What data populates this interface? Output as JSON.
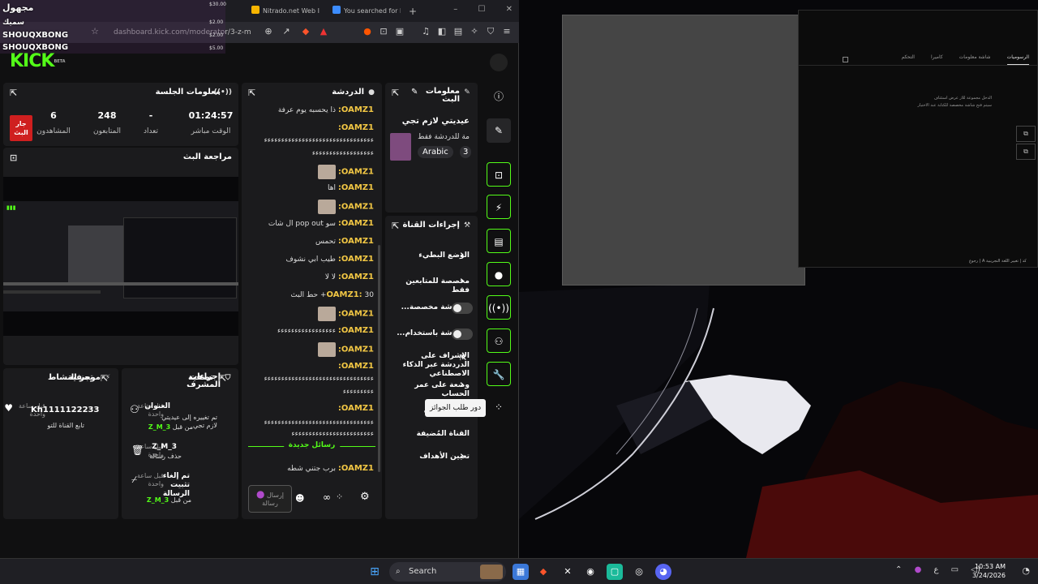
{
  "browser": {
    "tabs": [
      {
        "title": "Nitrado.net Web I",
        "color": "#f7b500"
      },
      {
        "title": "You searched for b",
        "color": "#3c8cff"
      }
    ],
    "new_tab": "+",
    "address": "dashboard.kick.com/moderator/3-z-m",
    "window_controls": [
      "–",
      "☐",
      "✕"
    ]
  },
  "donations": {
    "header": "مجهول",
    "rows": [
      {
        "name": "سميك",
        "amount": "$2.00"
      },
      {
        "name": "SHOUQXBONG",
        "amount": "$2.00"
      },
      {
        "name": "SHOUQXBONG",
        "amount": "$5.00"
      }
    ],
    "top_amount": "$30.00"
  },
  "kick": {
    "logo": "KICK",
    "beta": "BETA"
  },
  "session": {
    "title": "معلومات الجلسة",
    "stats": [
      {
        "value": "01:24:57",
        "label": "الوقت مباشر"
      },
      {
        "value": "-",
        "label": "تعداد"
      },
      {
        "value": "248",
        "label": "المتابعون"
      },
      {
        "value": "6",
        "label": "المشاهدون"
      }
    ],
    "live_badge": "جار البث"
  },
  "preview": {
    "title": "مراجعة البث"
  },
  "chat": {
    "title": "الدردشة",
    "messages": [
      {
        "user": "OAMZ1:",
        "text": "ذا يحسبه يوم عرفة"
      },
      {
        "user": "OAMZ1:",
        "text": ""
      },
      {
        "user": "",
        "text": "ءءءءءءءءءءءءءءءءءءءءءءءءءءءءءءءء"
      },
      {
        "user": "",
        "text": "ءءءءءءءءءءءءءءءءءء"
      },
      {
        "user": "OAMZ1:",
        "text": "",
        "emote": true
      },
      {
        "user": "OAMZ1:",
        "text": "اها"
      },
      {
        "user": "OAMZ1:",
        "text": "",
        "emote": true
      },
      {
        "user": "OAMZ1:",
        "text": "سو pop out ال شات"
      },
      {
        "user": "OAMZ1:",
        "text": "تحمس"
      },
      {
        "user": "OAMZ1:",
        "text": "طيب ابي نشوف"
      },
      {
        "user": "OAMZ1:",
        "text": "لا لا"
      },
      {
        "user": "OAMZ1:",
        "text": "30+ حط البث"
      },
      {
        "user": "OAMZ1:",
        "text": "",
        "emote": true
      },
      {
        "user": "OAMZ1:",
        "text": "ءءءءءءءءءءءءءءءءء"
      },
      {
        "user": "OAMZ1:",
        "text": "",
        "emote": true
      },
      {
        "user": "OAMZ1:",
        "text": ""
      },
      {
        "user": "",
        "text": "ءءءءءءءءءءءءءءءءءءءءءءءءءءءءءءءء"
      },
      {
        "user": "",
        "text": "ءءءءءءءءء"
      },
      {
        "user": "OAMZ1:",
        "text": ""
      },
      {
        "user": "",
        "text": "ءءءءءءءءءءءءءءءءءءءءءءءءءءءءءءءء"
      },
      {
        "user": "",
        "text": "ءءءءءءءءءءءءءءءءءءءءءءءء"
      }
    ],
    "new_messages": "رسائل جديدة",
    "last_message": {
      "user": "OAMZ1:",
      "text": "برب جتني شطه"
    },
    "input_placeholder": "إرسال رسالة"
  },
  "stream_info": {
    "title": "معلومات البث",
    "stream_title": "عيديتي لازم تجي",
    "category_text": "مة للدردشة فقط",
    "language": "Arabic",
    "count": "3"
  },
  "channel_actions": {
    "title": "إجراءات القناة",
    "rows": [
      {
        "label": "الوضع البطيء",
        "kind": "chevron"
      },
      {
        "label": "مخصصة للمتابعين فقط",
        "kind": "chevron"
      },
      {
        "label": "الدردشة مخصصة...",
        "kind": "toggle"
      },
      {
        "label": "الدردشة باستخدام...",
        "kind": "toggle"
      },
      {
        "label": "الإشراف على الدردشة عبر الذكاء الاصطناعي",
        "kind": "external"
      },
      {
        "label": "وضعة على عمر الحساب",
        "kind": "chevron"
      },
      {
        "label": "ت المحظورة",
        "kind": "none"
      },
      {
        "label": "القناة المُضيفة",
        "kind": "none"
      },
      {
        "label": "تعيين الأهداف",
        "kind": "chevron"
      }
    ],
    "tooltip": "دور طلب الجوائز"
  },
  "activity": {
    "title": "موجز النشاط",
    "filter": "تصفية",
    "item": {
      "time": "قبل ساعة واحدة",
      "name": "Kh1111122233",
      "sub": "تابع القناة للتو"
    }
  },
  "mod_actions": {
    "title": "إجراءات المشرف",
    "filter": "تصفية",
    "items": [
      {
        "time": "قبل ساعة واحدة",
        "title": "العنوان",
        "sub": "تم تغييره إلى عيديتي لازم تجي",
        "by": "3_Z_M",
        "by_suffix": "من قبل"
      },
      {
        "time": "قبل ساعة واحدة",
        "title": "3_Z_M",
        "sub": "حذف رسالة",
        "by": "",
        "by_suffix": ""
      },
      {
        "time": "قبل ساعة واحدة",
        "title": "تم إلغاء تثبيت الرسالة",
        "sub": "",
        "by": "3_Z_M",
        "by_suffix": "من قبل"
      }
    ]
  },
  "dark_window": {
    "tabs": [
      "الرسوميات",
      "شاشة معلومات",
      "كاميرا",
      "التحكم"
    ],
    "note_line1": "الدخل مجموعة للاز عرض استئناف",
    "note_line2": "سيتم فتح شاشة مخصصة للكتابة عند الاختيار",
    "footer": "رجوع  |  A  كد  |  تغيير اللغة التجريبية"
  },
  "taskbar": {
    "search": "Search",
    "time": "10:53 AM",
    "date": "3/24/2026",
    "lang": "ع"
  }
}
